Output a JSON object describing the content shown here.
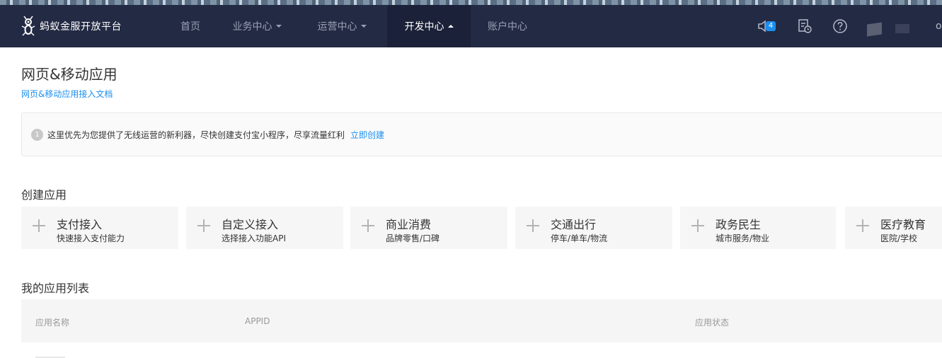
{
  "brand": {
    "name": "蚂蚁金服开放平台",
    "logo": "ant-logo-icon"
  },
  "nav": [
    {
      "label": "首页",
      "dropdown": false,
      "active": false
    },
    {
      "label": "业务中心",
      "dropdown": true,
      "active": false
    },
    {
      "label": "运营中心",
      "dropdown": true,
      "active": false
    },
    {
      "label": "开发中心",
      "dropdown": true,
      "active": true
    },
    {
      "label": "账户中心",
      "dropdown": false,
      "active": false
    }
  ],
  "header_icons": {
    "notification_count": "4",
    "extra_text": "o"
  },
  "page": {
    "title": "网页&移动应用",
    "doc_link": "网页&移动应用接入文档"
  },
  "notice": {
    "icon_text": "1",
    "text": "这里优先为您提供了无线运营的新利器，尽快创建支付宝小程序，尽享流量红利",
    "link": "立即创建"
  },
  "create_section": {
    "title": "创建应用",
    "cards": [
      {
        "title": "支付接入",
        "subtitle": "快速接入支付能力"
      },
      {
        "title": "自定义接入",
        "subtitle": "选择接入功能API"
      },
      {
        "title": "商业消费",
        "subtitle": "品牌零售/口碑"
      },
      {
        "title": "交通出行",
        "subtitle": "停车/单车/物流"
      },
      {
        "title": "政务民生",
        "subtitle": "城市服务/物业"
      },
      {
        "title": "医疗教育",
        "subtitle": "医院/学校"
      }
    ]
  },
  "app_list": {
    "title": "我的应用列表",
    "columns": [
      "应用名称",
      "APPID",
      "应用状态"
    ]
  },
  "colors": {
    "header_bg": "#232a43",
    "active_nav_bg": "#1b2138",
    "link": "#1b8ff0",
    "card_bg": "#f6f6f7"
  }
}
